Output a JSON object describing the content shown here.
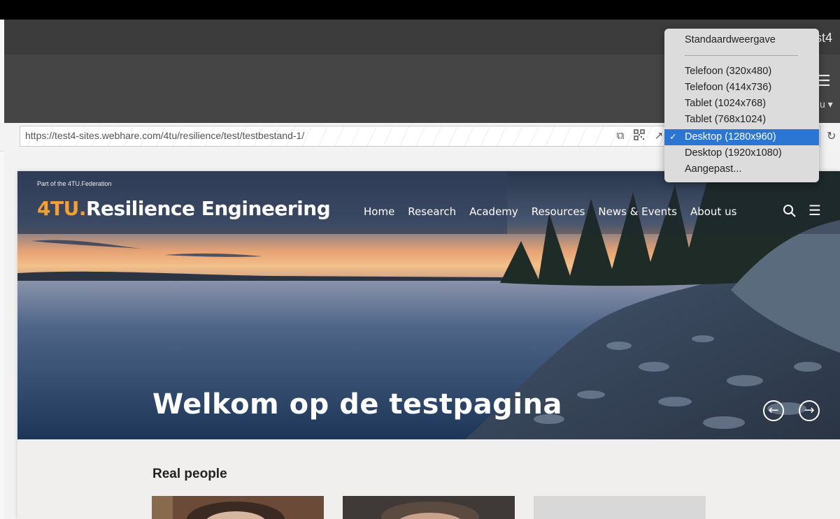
{
  "browser": {
    "title_fragment": "st4",
    "url": "https://test4-sites.webhare.com/4tu/resilience/test/testbestand-1/",
    "right_menu_label": "u ▾",
    "icons": [
      "copy-icon",
      "qr-code-icon",
      "open-external-icon",
      "reload-icon",
      "hamburger-icon"
    ]
  },
  "device_menu": {
    "default_label": "Standaardweergave",
    "items": [
      {
        "label": "Telefoon (320x480)",
        "selected": false
      },
      {
        "label": "Telefoon (414x736)",
        "selected": false
      },
      {
        "label": "Tablet (1024x768)",
        "selected": false
      },
      {
        "label": "Tablet (768x1024)",
        "selected": false
      },
      {
        "label": "Desktop (1280x960)",
        "selected": true
      },
      {
        "label": "Desktop (1920x1080)",
        "selected": false
      },
      {
        "label": "Aangepast...",
        "selected": false
      }
    ],
    "checkmark": "✓"
  },
  "site": {
    "federation": "Part of the 4TU.Federation",
    "logo_prefix": "4TU.",
    "logo_main": "Resilience Engineering",
    "nav": [
      "Home",
      "Research",
      "Academy",
      "Resources",
      "News & Events",
      "About us"
    ],
    "hero_heading": "Welkom op de testpagina",
    "prev_arrow": "←",
    "next_arrow": "→",
    "section_heading": "Real people",
    "accent_color": "#f2a033",
    "selection_color": "#2b76d2"
  }
}
